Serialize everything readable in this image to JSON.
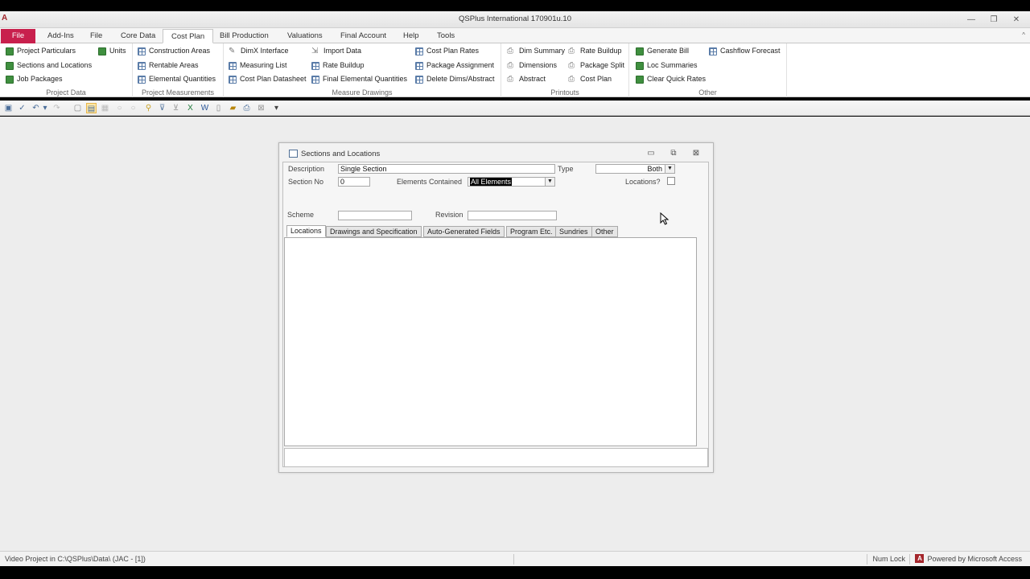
{
  "window": {
    "title": "QSPlus International 170901u.10",
    "app_icon_glyph": "A",
    "minimize_glyph": "—",
    "restore_glyph": "❐",
    "close_glyph": "✕"
  },
  "ribbon_tabs": [
    {
      "label": "File"
    },
    {
      "label": "Add-Ins"
    },
    {
      "label": "File"
    },
    {
      "label": "Core Data"
    },
    {
      "label": "Cost Plan"
    },
    {
      "label": "Bill Production"
    },
    {
      "label": "Valuations"
    },
    {
      "label": "Final Account"
    },
    {
      "label": "Help"
    },
    {
      "label": "Tools"
    }
  ],
  "ribbon": {
    "collapse_glyph": "^",
    "groups": {
      "project_data": {
        "label": "Project Data",
        "items": [
          "Project Particulars",
          "Sections and Locations",
          "Job Packages",
          "Units"
        ]
      },
      "project_measurements": {
        "label": "Project Measurements",
        "items": [
          "Construction Areas",
          "Rentable Areas",
          "Elemental Quantities"
        ]
      },
      "measure_drawings": {
        "label": "Measure Drawings",
        "items": [
          "DimX Interface",
          "Measuring List",
          "Cost Plan Datasheet",
          "Import Data",
          "Rate Buildup",
          "Final Elemental Quantities",
          "Cost Plan Rates",
          "Package Assignment",
          "Delete Dims/Abstract"
        ]
      },
      "printouts": {
        "label": "Printouts",
        "items": [
          "Dim Summary",
          "Dimensions",
          "Abstract",
          "Rate Buildup",
          "Package Split",
          "Cost Plan"
        ]
      },
      "other": {
        "label": "Other",
        "items": [
          "Generate Bill",
          "Loc Summaries",
          "Clear Quick Rates",
          "Cashflow Forecast"
        ]
      }
    }
  },
  "dialog": {
    "title": "Sections and Locations",
    "min_glyph": "▭",
    "max_glyph": "⧉",
    "close_glyph": "⊠",
    "fields": {
      "description_label": "Description",
      "description_value": "Single Section",
      "type_label": "Type",
      "type_value": "Both",
      "section_no_label": "Section No",
      "section_no_value": "0",
      "elements_label": "Elements Contained",
      "elements_value": "All Elements",
      "locations_label": "Locations?",
      "locations_checked": false,
      "scheme_label": "Scheme",
      "scheme_value": "",
      "revision_label": "Revision",
      "revision_value": ""
    },
    "tabs": [
      "Locations",
      "Drawings and Specification",
      "Auto-Generated Fields",
      "Program Etc.",
      "Sundries",
      "Other"
    ],
    "active_tab": "Locations"
  },
  "status": {
    "left": "Video Project in C:\\QSPlus\\Data\\ (JAC - [1])",
    "numlock": "Num Lock",
    "powered": "Powered by Microsoft Access",
    "access_glyph": "A"
  },
  "colors": {
    "file_tab": "#c8204d",
    "accent": "#4f6f96"
  }
}
